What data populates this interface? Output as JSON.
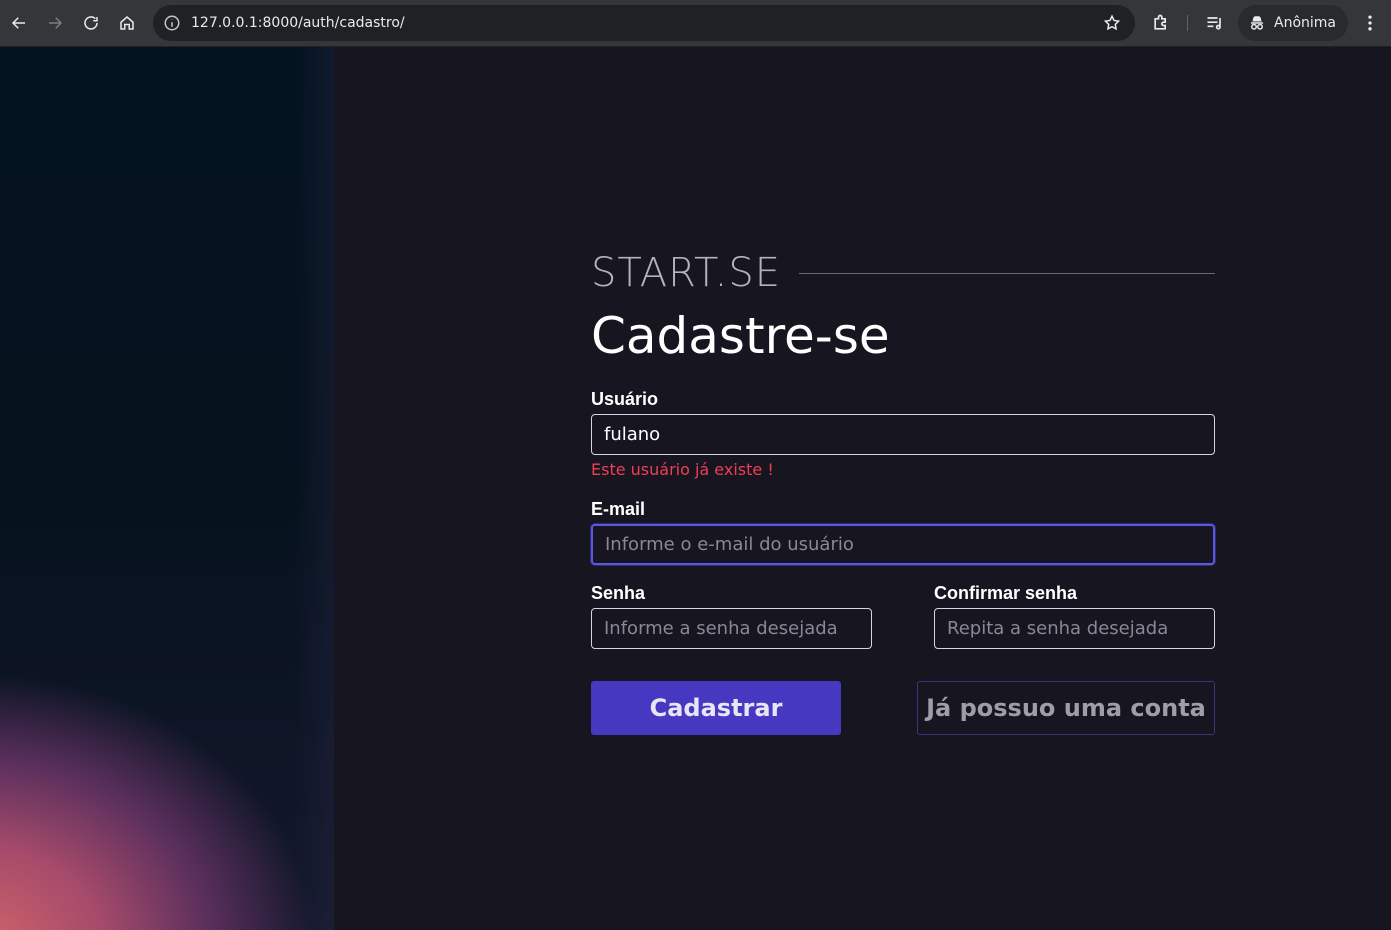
{
  "browser": {
    "url": "127.0.0.1:8000/auth/cadastro/",
    "profile_label": "Anônima"
  },
  "form": {
    "brand": "START.SE",
    "title": "Cadastre-se",
    "username": {
      "label": "Usuário",
      "value": "fulano",
      "error": "Este usuário já existe !"
    },
    "email": {
      "label": "E-mail",
      "placeholder": "Informe o e-mail do usuário"
    },
    "password": {
      "label": "Senha",
      "placeholder": "Informe a senha desejada"
    },
    "confirm_password": {
      "label": "Confirmar senha",
      "placeholder": "Repita a senha desejada"
    },
    "submit_label": "Cadastrar",
    "login_label": "Já possuo uma conta"
  },
  "colors": {
    "background": "#17151f",
    "accent": "#4638c0",
    "error": "#ef3e55",
    "focus": "#5b57e0"
  }
}
